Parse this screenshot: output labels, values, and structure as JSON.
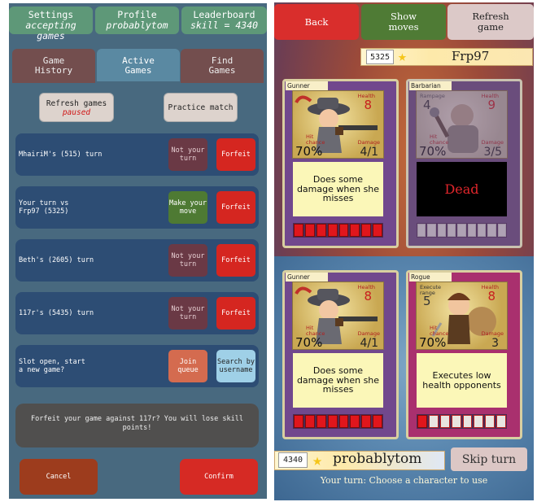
{
  "left": {
    "top": {
      "settings": {
        "title": "Settings",
        "sub": "accepting games"
      },
      "profile": {
        "title": "Profile",
        "sub": "probablytom"
      },
      "leaderboard": {
        "title": "Leaderboard",
        "sub": "skill = 4340"
      }
    },
    "tabs": [
      {
        "label1": "Game",
        "label2": "History"
      },
      {
        "label1": "Active",
        "label2": "Games"
      },
      {
        "label1": "Find",
        "label2": "Games"
      }
    ],
    "refresh": {
      "title": "Refresh games",
      "status": "paused"
    },
    "practice": "Practice match",
    "games": [
      {
        "text": "MhairiM's (515) turn",
        "action": "Not your turn",
        "forfeit": "Forfeit"
      },
      {
        "text1": "Your turn vs",
        "text2": "Frp97 (5325)",
        "action": "Make your move",
        "forfeit": "Forfeit"
      },
      {
        "text": "Beth's (2605) turn",
        "action": "Not your turn",
        "forfeit": "Forfeit"
      },
      {
        "text": "117r's (5435) turn",
        "action": "Not your turn",
        "forfeit": "Forfeit"
      },
      {
        "text1": "Slot open, start",
        "text2": "a new game?",
        "join": "Join queue",
        "search": "Search by username"
      }
    ],
    "dialog": "Forfeit your game against 117r? You will lose skill points!",
    "cancel": "Cancel",
    "confirm": "Confirm"
  },
  "right": {
    "back": "Back",
    "show_moves": "Show moves",
    "refresh": "Refresh game",
    "opponent": {
      "score": "5325",
      "name": "Frp97"
    },
    "player": {
      "score": "4340",
      "name": "probablytom"
    },
    "skip": "Skip turn",
    "status": "Your turn: Choose a character to use",
    "cards": [
      {
        "name": "Gunner",
        "health_label": "Health",
        "health": "8",
        "hit_label": "Hit chance",
        "hit": "70%",
        "damage_label": "Damage",
        "damage": "4/1",
        "desc": "Does some damage when she misses",
        "hp_total": 8,
        "hp_current": 8
      },
      {
        "name": "Barbarian",
        "health_label": "Health",
        "health": "9",
        "hit_label": "Hit chance",
        "hit": "70%",
        "damage_label": "Damage",
        "damage": "3/5",
        "top_left_label": "Rampage",
        "top_left": "4",
        "status": "Dead",
        "hp_total": 9,
        "hp_current": 0
      },
      {
        "name": "Gunner",
        "health_label": "Health",
        "health": "8",
        "hit_label": "Hit chance",
        "hit": "70%",
        "damage_label": "Damage",
        "damage": "4/1",
        "desc": "Does some damage when she misses",
        "hp_total": 8,
        "hp_current": 8
      },
      {
        "name": "Rogue",
        "health_label": "Health",
        "health": "8",
        "hit_label": "Hit chance",
        "hit": "70%",
        "damage_label": "Damage",
        "damage": "3",
        "top_left_label": "Execute range",
        "top_left": "5",
        "desc": "Executes low health opponents",
        "hp_total": 8,
        "hp_current": 1
      }
    ]
  }
}
